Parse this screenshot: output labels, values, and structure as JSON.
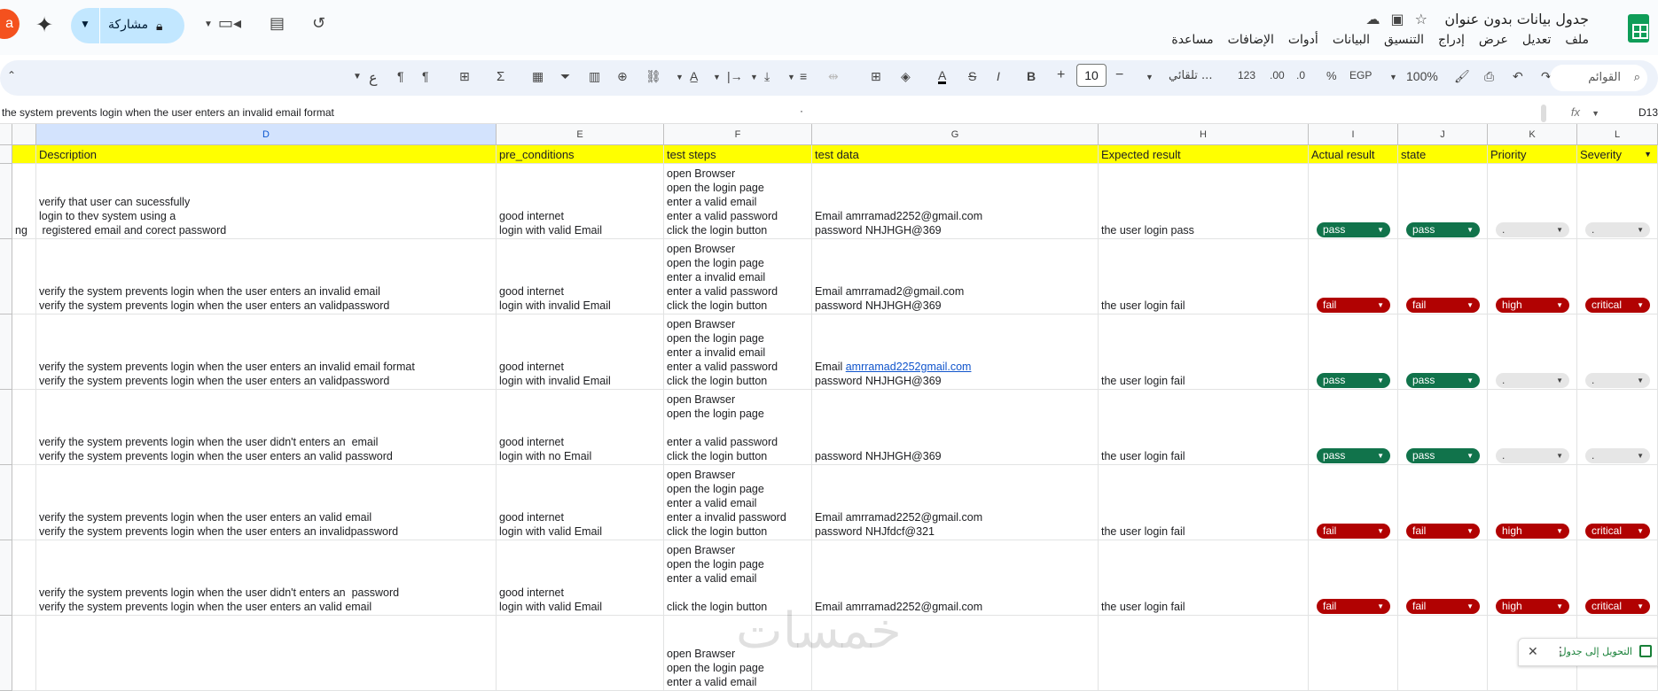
{
  "app": {
    "doc_title": "جدول بيانات بدون عنوان",
    "menus": [
      "ملف",
      "تعديل",
      "عرض",
      "إدراج",
      "التنسيق",
      "البيانات",
      "أدوات",
      "الإضافات",
      "مساعدة"
    ],
    "share_label": "مشاركة",
    "avatar_letter": "a"
  },
  "toolbar": {
    "search_label": "القوائم",
    "zoom": "100%",
    "currency": "EGP",
    "percent": "%",
    "dec_decrease": ".0",
    "dec_increase": ".00",
    "number_format": "123",
    "font_name": "تلقائي ...",
    "font_size": "10",
    "bold": "B",
    "italic": "I",
    "function": "Σ"
  },
  "formula_bar": {
    "name_box": "D13",
    "fx": "fx",
    "content": "the system prevents login when the user enters an invalid email format"
  },
  "columns": [
    {
      "letter": "D",
      "header": "Description"
    },
    {
      "letter": "E",
      "header": "pre_conditions"
    },
    {
      "letter": "F",
      "header": "test steps"
    },
    {
      "letter": "G",
      "header": "test data"
    },
    {
      "letter": "H",
      "header": "Expected result"
    },
    {
      "letter": "I",
      "header": "Actual result"
    },
    {
      "letter": "J",
      "header": "state"
    },
    {
      "letter": "K",
      "header": "Priority"
    },
    {
      "letter": "L",
      "header": "Severity"
    }
  ],
  "rows": [
    {
      "c_fragment": "ng",
      "description": "verify that user can sucessfully\nlogin to thev system using a\n registered email and corect password",
      "pre_conditions": "good internet\nlogin with valid Email",
      "test_steps": "open Browser\nopen the login page\nenter a valid email\nenter a valid password\nclick the login button",
      "test_data_email_prefix": "Email ",
      "test_data_email": "amrramad2252@gmail.com",
      "test_data_password": "password NHJHGH@369",
      "expected": "the user login pass",
      "actual": "pass",
      "state": "pass",
      "priority": ".",
      "severity": "."
    },
    {
      "c_fragment": "",
      "description": "verify the system prevents login when the user enters an invalid email\nverify the system prevents login when the user enters an validpassword",
      "pre_conditions": "good internet\nlogin with invalid Email",
      "test_steps": "open Browser\nopen the login page\nenter a invalid email\nenter a valid password\nclick the login button",
      "test_data_email_prefix": "Email ",
      "test_data_email": "amrramad2@gmail.com",
      "test_data_password": "password NHJHGH@369",
      "expected": "the user login fail",
      "actual": "fail",
      "state": "fail",
      "priority": "high",
      "severity": "critical"
    },
    {
      "c_fragment": "",
      "description": "verify the system prevents login when the user enters an invalid email format\nverify the system prevents login when the user enters an validpassword",
      "pre_conditions": "good internet\nlogin with invalid Email",
      "test_steps": "open Brawser\nopen the login page\nenter a invalid email\nenter a valid password\nclick the login button",
      "test_data_email_prefix": "Email ",
      "test_data_email_link": "amrramad2252gmail.com",
      "test_data_password": "password NHJHGH@369",
      "expected": "the user login fail",
      "actual": "pass",
      "state": "pass",
      "priority": ".",
      "severity": "."
    },
    {
      "c_fragment": "",
      "description": "verify the system prevents login when the user didn't enters an  email\nverify the system prevents login when the user enters an valid password",
      "pre_conditions": "good internet\nlogin with no Email",
      "test_steps": "open Brawser\nopen the login page\n\nenter a valid password\nclick the login button",
      "test_data_email_prefix": "",
      "test_data_email": "",
      "test_data_password": "password NHJHGH@369",
      "expected": "the user login fail",
      "actual": "pass",
      "state": "pass",
      "priority": ".",
      "severity": "."
    },
    {
      "c_fragment": "",
      "description": "verify the system prevents login when the user enters an valid email\nverify the system prevents login when the user enters an invalidpassword",
      "pre_conditions": "good internet\nlogin with valid Email",
      "test_steps": "open Brawser\nopen the login page\nenter a valid email\nenter a invalid password\nclick the login button",
      "test_data_email_prefix": "Email ",
      "test_data_email": "amrramad2252@gmail.com",
      "test_data_password": "password NHJfdcf@321",
      "expected": "the user login fail",
      "actual": "fail",
      "state": "fail",
      "priority": "high",
      "severity": "critical"
    },
    {
      "c_fragment": "",
      "description": "verify the system prevents login when the user didn't enters an  password\nverify the system prevents login when the user enters an valid email",
      "pre_conditions": "good internet\nlogin with valid Email",
      "test_steps": "open Brawser\nopen the login page\nenter a valid email\n\nclick the login button",
      "test_data_email_prefix": "Email ",
      "test_data_email": "amrramad2252@gmail.com",
      "test_data_password": "",
      "expected": "the user login fail",
      "actual": "fail",
      "state": "fail",
      "priority": "high",
      "severity": "critical"
    },
    {
      "c_fragment": "",
      "description": "",
      "pre_conditions": "",
      "test_steps": "open Brawser\nopen the login page\nenter a valid email",
      "test_data_email_prefix": "",
      "test_data_email": "",
      "test_data_password": "",
      "expected": "",
      "actual": "",
      "state": "",
      "priority": "",
      "severity": ""
    }
  ],
  "colors": {
    "pass": "#11734b",
    "fail": "#b10202",
    "header_fill": "#ffff00",
    "share_bg": "#c2e7ff",
    "link": "#1155cc"
  },
  "watermark": "خمسات",
  "convert_banner": "التحويل إلى جدول"
}
